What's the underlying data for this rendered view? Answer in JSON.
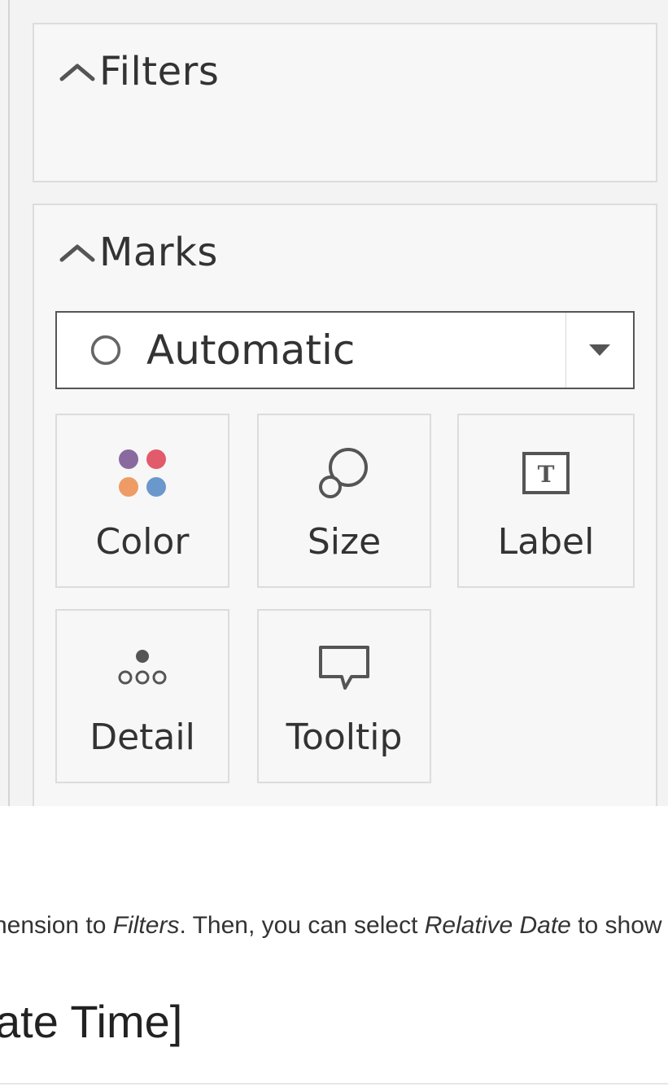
{
  "filters_card": {
    "title": "Filters"
  },
  "marks_card": {
    "title": "Marks",
    "mark_type": {
      "selected": "Automatic"
    },
    "buttons": [
      {
        "label": "Color",
        "icon": "color-dots-icon"
      },
      {
        "label": "Size",
        "icon": "size-circles-icon"
      },
      {
        "label": "Label",
        "icon": "text-label-icon"
      },
      {
        "label": "Detail",
        "icon": "detail-dots-icon"
      },
      {
        "label": "Tooltip",
        "icon": "speech-bubble-icon"
      }
    ]
  },
  "doc": {
    "text_part1": "nension to ",
    "text_em1": "Filters",
    "text_part2": ". Then, you can select ",
    "text_em2": "Relative Date",
    "text_part3": " to show a",
    "heading": "ate Time]"
  },
  "colors": {
    "dot_purple": "#8a6a9e",
    "dot_red": "#e25b6b",
    "dot_orange": "#ee9b66",
    "dot_blue": "#6a98cc"
  }
}
